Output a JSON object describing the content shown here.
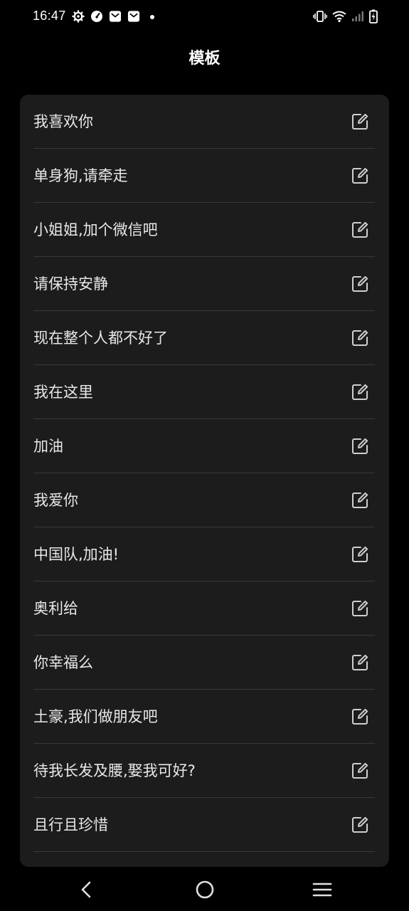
{
  "status_bar": {
    "time": "16:47",
    "left_icons": [
      "gear-icon",
      "speedometer-icon",
      "mail-icon",
      "mail-icon",
      "dot-icon"
    ],
    "right_icons": [
      "vibrate-icon",
      "wifi-icon",
      "signal-icon",
      "battery-charging-icon"
    ]
  },
  "header": {
    "title": "模板"
  },
  "templates": [
    {
      "label": "我喜欢你"
    },
    {
      "label": "单身狗,请牵走"
    },
    {
      "label": "小姐姐,加个微信吧"
    },
    {
      "label": "请保持安静"
    },
    {
      "label": "现在整个人都不好了"
    },
    {
      "label": "我在这里"
    },
    {
      "label": "加油"
    },
    {
      "label": "我爱你"
    },
    {
      "label": "中国队,加油!"
    },
    {
      "label": "奥利给"
    },
    {
      "label": "你幸福么"
    },
    {
      "label": "土豪,我们做朋友吧"
    },
    {
      "label": "待我长发及腰,娶我可好?"
    },
    {
      "label": "且行且珍惜"
    }
  ],
  "nav_bar": {
    "buttons": [
      "back-icon",
      "home-icon",
      "menu-icon"
    ]
  },
  "colors": {
    "background": "#000000",
    "card": "#1c1c1c",
    "divider": "#383838",
    "text": "#e8e8e8",
    "icon": "#cfcfcf"
  }
}
